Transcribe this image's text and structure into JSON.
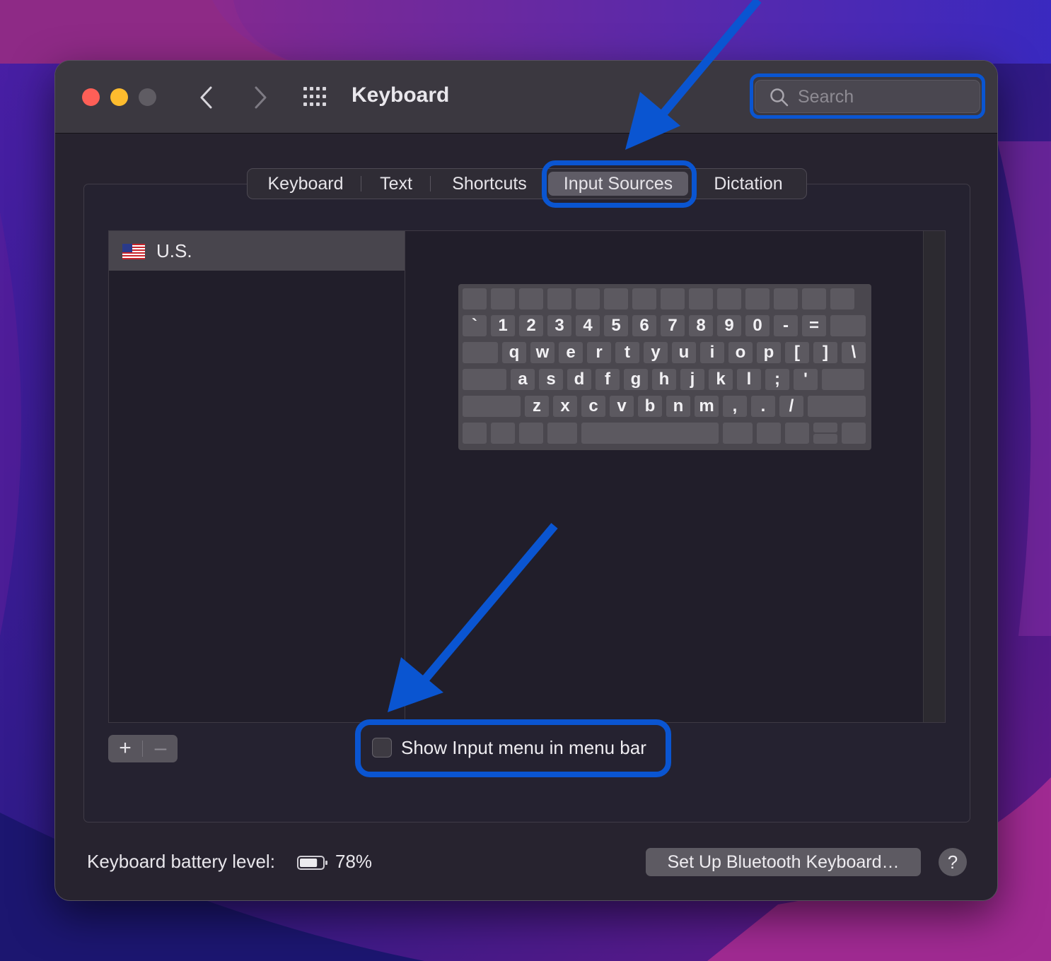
{
  "window": {
    "title": "Keyboard",
    "traffic_lights": [
      "close-button",
      "minimize-button",
      "zoom-button"
    ],
    "nav_icons": {
      "back": "chevron-left-icon",
      "forward": "chevron-right-icon",
      "show_all": "grid-icon"
    }
  },
  "search": {
    "placeholder": "Search",
    "value": "",
    "icon": "magnifier-icon"
  },
  "tabs": [
    {
      "label": "Keyboard",
      "selected": false
    },
    {
      "label": "Text",
      "selected": false
    },
    {
      "label": "Shortcuts",
      "selected": false
    },
    {
      "label": "Input Sources",
      "selected": true
    },
    {
      "label": "Dictation",
      "selected": false
    }
  ],
  "input_sources": [
    {
      "label": "U.S.",
      "icon": "us-flag-icon",
      "selected": true
    }
  ],
  "keyboard_layout": {
    "row1": [
      "`",
      "1",
      "2",
      "3",
      "4",
      "5",
      "6",
      "7",
      "8",
      "9",
      "0",
      "-",
      "="
    ],
    "row2": [
      "q",
      "w",
      "e",
      "r",
      "t",
      "y",
      "u",
      "i",
      "o",
      "p",
      "[",
      "]",
      "\\"
    ],
    "row3": [
      "a",
      "s",
      "d",
      "f",
      "g",
      "h",
      "j",
      "k",
      "l",
      ";",
      "'"
    ],
    "row4": [
      "z",
      "x",
      "c",
      "v",
      "b",
      "n",
      "m",
      ",",
      ".",
      "/"
    ]
  },
  "list_controls": {
    "add": "+",
    "remove": "–"
  },
  "checkbox": {
    "label": "Show Input menu in menu bar",
    "checked": false
  },
  "footer": {
    "battery_label": "Keyboard battery level:",
    "battery_value": "78%",
    "battery_fraction": 0.78,
    "bluetooth_button": "Set Up Bluetooth Keyboard…",
    "help_button": "?"
  },
  "colors": {
    "highlight": "#0a55d1",
    "window_bg": "#27232f",
    "titlebar_bg": "#3b3840",
    "close": "#fe5f57",
    "minimize": "#febc2e"
  }
}
